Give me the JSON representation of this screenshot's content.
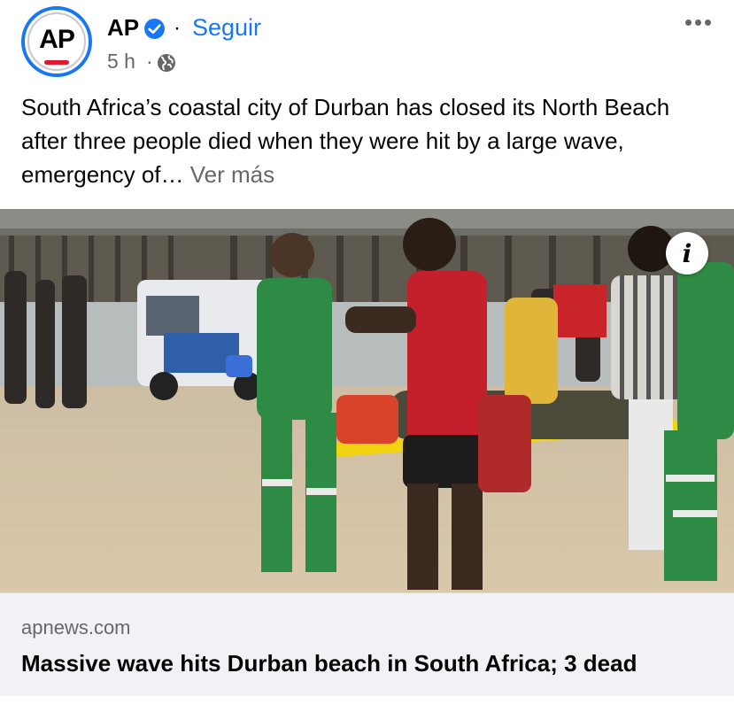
{
  "header": {
    "avatar_text": "AP",
    "page_name": "AP",
    "separator": "·",
    "follow_label": "Seguir",
    "time": "5 h",
    "time_separator": "·",
    "audience_icon": "globe-icon",
    "verified_icon": "verified-badge-icon",
    "more_icon": "more-options-icon"
  },
  "post": {
    "text": "South Africa’s coastal city of Durban has closed its North Beach after three people died when they were hit by a large wave, emergency of… ",
    "see_more_label": "Ver más"
  },
  "media": {
    "info_label": "i"
  },
  "link": {
    "domain": "apnews.com",
    "title": "Massive wave hits Durban beach in South Africa; 3 dead"
  },
  "colors": {
    "accent": "#1877f2",
    "secondary_text": "#65676b",
    "card_bg": "#f0f2f5",
    "ap_red": "#e0182d"
  }
}
